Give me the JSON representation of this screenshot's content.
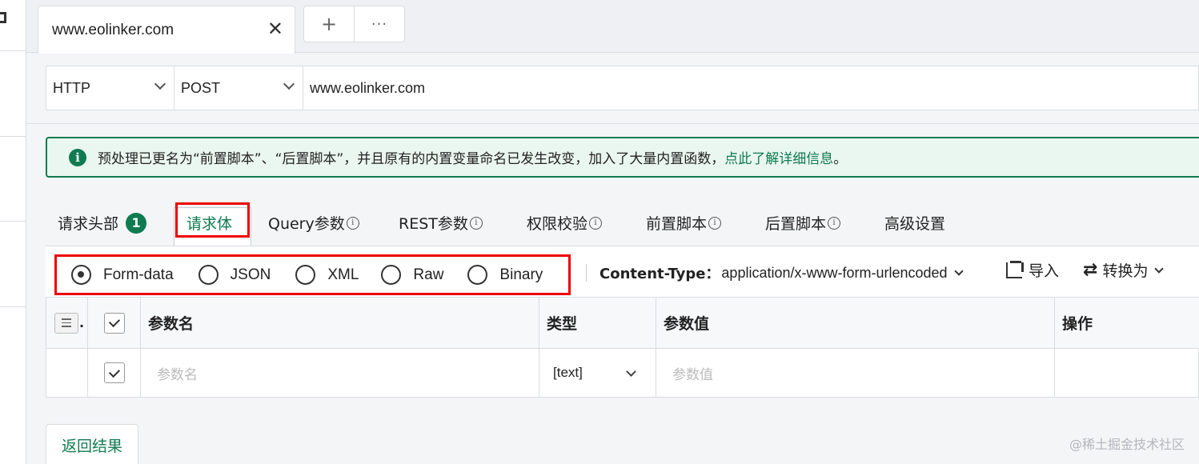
{
  "tabbar": {
    "tab_title": "www.eolinker.com",
    "close_glyph": "✕",
    "add_glyph": "+",
    "more_glyph": "···"
  },
  "request": {
    "protocol": "HTTP",
    "method": "POST",
    "url": "www.eolinker.com"
  },
  "notice": {
    "icon": "info-icon",
    "text": "预处理已更名为“前置脚本”、“后置脚本”，并且原有的内置变量命名已发生改变，加入了大量内置函数，",
    "link": "点此了解详细信息",
    "end": "。"
  },
  "subtabs": {
    "headers": "请求头部",
    "headers_badge": "1",
    "body": "请求体",
    "query": "Query参数",
    "rest": "REST参数",
    "auth": "权限校验",
    "pre_script": "前置脚本",
    "post_script": "后置脚本",
    "advanced": "高级设置"
  },
  "body_type": {
    "options": [
      "Form-data",
      "JSON",
      "XML",
      "Raw",
      "Binary"
    ],
    "selected": "Form-data"
  },
  "content_type": {
    "label": "Content-Type：",
    "value": "application/x-www-form-urlencoded"
  },
  "actions": {
    "import": "导入",
    "convert": "转换为"
  },
  "table": {
    "headers": {
      "dot": ".",
      "name": "参数名",
      "type": "类型",
      "value": "参数值",
      "ops": "操作"
    },
    "row": {
      "name_placeholder": "参数名",
      "type": "[text]",
      "value_placeholder": "参数值"
    }
  },
  "result_tab": "返回结果",
  "watermark": "@稀土掘金技术社区",
  "colors": {
    "accent": "#0f7b50",
    "highlight": "#e00000"
  }
}
